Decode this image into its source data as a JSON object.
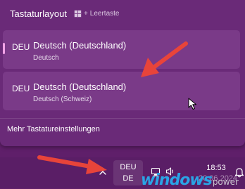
{
  "flyout": {
    "title": "Tastaturlayout",
    "shortcut_key": "Leertaste",
    "items": [
      {
        "code": "DEU",
        "name": "Deutsch (Deutschland)",
        "sub": "Deutsch",
        "selected": true
      },
      {
        "code": "DEU",
        "name": "Deutsch (Deutschland)",
        "sub": "Deutsch (Schweiz)",
        "selected": false
      }
    ],
    "more_settings": "Mehr Tastatureinstellungen"
  },
  "taskbar": {
    "ime_line1": "DEU",
    "ime_line2": "DE",
    "time": "18:53",
    "date": "20.06.2024",
    "tray_icons": [
      "chevron-up-icon",
      "network-icon",
      "speaker-icon",
      "bell-icon"
    ]
  },
  "watermark": {
    "main": "windows",
    "sub": "power"
  },
  "colors": {
    "flyout_bg": "#6a2a78",
    "item_bg": "#7a3a88",
    "selection_accent": "#f2a3e8",
    "taskbar_bg": "#5a1e66",
    "arrow_red": "#e8443a"
  }
}
